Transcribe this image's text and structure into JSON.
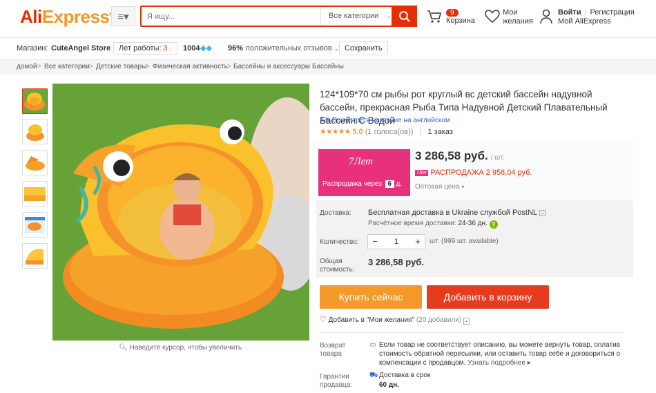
{
  "header": {
    "logo_a": "Ali",
    "logo_b": "Express",
    "logo_mark": "®",
    "search_placeholder": "Я ищу...",
    "search_category": "Все категории",
    "cart_count": "9",
    "cart_label": "Корзина",
    "wishlist_line1": "Мои",
    "wishlist_line2": "желания",
    "login": "Войти",
    "register": "Регистрация",
    "my_account": "Мой AliExpress"
  },
  "store": {
    "label": "Магазин:",
    "name": "CuteAngel Store",
    "years_label": "Лет работы:",
    "years": "3",
    "score": "1004",
    "positive": "96%",
    "positive_label": "положительных отзывов",
    "save": "Сохранить"
  },
  "breadcrumb": [
    "домой",
    "Все категории",
    "Детские товары",
    "Физическая активность",
    "Бассейны и аксессуары",
    "Бассейны"
  ],
  "gallery": {
    "thumbs": 6,
    "zoom_hint": "Наведите курсор, чтобы увеличить"
  },
  "product": {
    "title": "124*109*70 см рыбы рот круглый вс детский бассейн надувной бассейн, прекрасная Рыба Типа Надувной Детский Плавательный Бассейн С Водой",
    "english_name": "Посмотреть название на английском",
    "stars": "★★★★★",
    "rating": "5.0",
    "votes": "(1 голоса(ов))",
    "orders": "1 заказ"
  },
  "promo": {
    "days_label": "7Лет",
    "sale_in": "Распродажа через",
    "days": "6",
    "days_unit": "д."
  },
  "price": {
    "value": "3 286,58 руб.",
    "unit": "/ шт.",
    "sale_icon": "7Лет",
    "sale": "РАСПРОДАЖА 2 958,04 руб.",
    "wholesale": "Оптовая цена"
  },
  "shipping": {
    "label": "Доставка:",
    "text": "Бесплатная доставка в Ukraine службой PostNL",
    "eta_label": "Расчётное время доставки:",
    "eta": "24-36",
    "eta_unit": "дн."
  },
  "quantity": {
    "label": "Количество:",
    "value": "1",
    "available": "шт. (999 шт. available)"
  },
  "total": {
    "label_1": "Общая",
    "label_2": "стоимость:",
    "value": "3 286,58 руб."
  },
  "actions": {
    "buy": "Купить сейчас",
    "cart": "Добавить в корзину",
    "wish": "Добавить в \"Мои желания\"",
    "wish_count": "(20 добавили)"
  },
  "returns": {
    "label_1": "Возврат",
    "label_2": "товара",
    "text": "Если товар не соответствует описанию, вы можете вернуть товар, оплатив стоимость обратной пересылки, или оставить товар себе и договориться о компенсации с продавцом.",
    "more": "Узнать подробнее"
  },
  "guarantee": {
    "label_1": "Гарантии",
    "label_2": "продавца:",
    "title": "Доставка в срок",
    "days": "60 дн."
  },
  "colors": {
    "accent": "#e62e04",
    "orange": "#f49a2a",
    "pink": "#e7317d"
  }
}
